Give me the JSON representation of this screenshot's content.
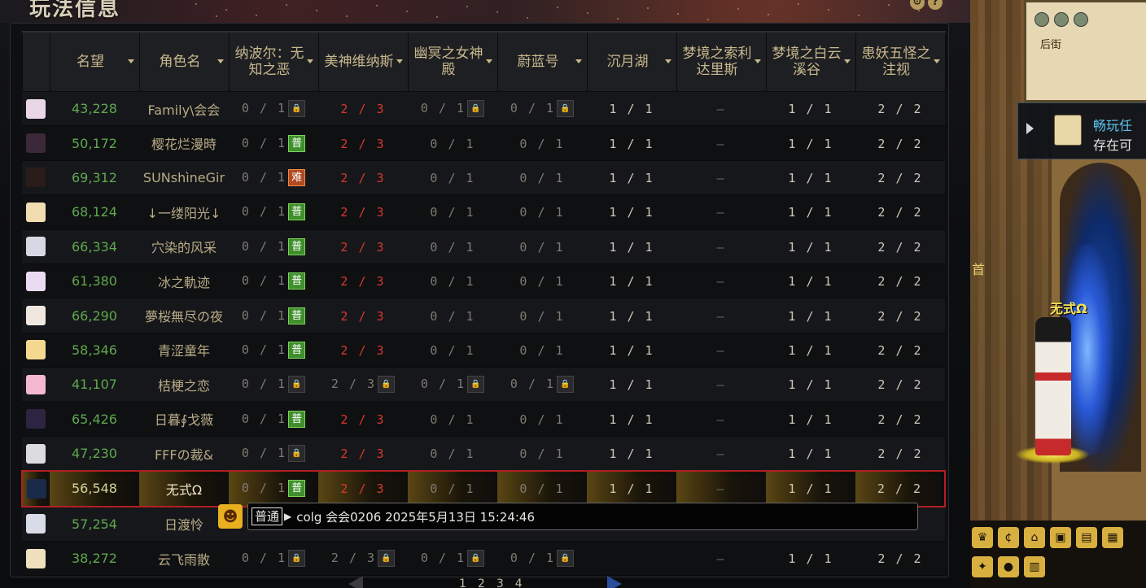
{
  "panel": {
    "title": "玩法信息",
    "settings_icon": "gear-icon",
    "help_icon": "help-icon"
  },
  "columns": [
    {
      "label": "名望"
    },
    {
      "label": "角色名"
    },
    {
      "label": "纳波尔：无知之恶"
    },
    {
      "label": "美神维纳斯"
    },
    {
      "label": "幽冥之女神殿"
    },
    {
      "label": "蔚蓝号"
    },
    {
      "label": "沉月湖"
    },
    {
      "label": "梦境之索利达里斯"
    },
    {
      "label": "梦境之白云溪谷"
    },
    {
      "label": "患妖五怪之注视"
    }
  ],
  "rows": [
    {
      "score": "43,228",
      "name": "Family\\会会",
      "d1": "0 / 1",
      "d1b": "lock",
      "d2": "2 / 3",
      "d2r": true,
      "d3": "0 / 1",
      "d3b": "lock",
      "d4": "0 / 1",
      "d4b": "lock",
      "d5": "1 / 1",
      "d6": "—",
      "d7": "1 / 1",
      "d8": "2 / 2",
      "av": "#e9d7e8"
    },
    {
      "score": "50,172",
      "name": "樱花烂漫時",
      "d1": "0 / 1",
      "d1b": "普",
      "d2": "2 / 3",
      "d2r": true,
      "d3": "0 / 1",
      "d4": "0 / 1",
      "d5": "1 / 1",
      "d6": "—",
      "d7": "1 / 1",
      "d8": "2 / 2",
      "av": "#3b2838"
    },
    {
      "score": "69,312",
      "name": "SUNshìneGir",
      "d1": "0 / 1",
      "d1b": "难",
      "d2": "2 / 3",
      "d2r": true,
      "d3": "0 / 1",
      "d4": "0 / 1",
      "d5": "1 / 1",
      "d6": "—",
      "d7": "1 / 1",
      "d8": "2 / 2",
      "av": "#2a1c1a"
    },
    {
      "score": "68,124",
      "name": "↓一缕阳光↓",
      "d1": "0 / 1",
      "d1b": "普",
      "d2": "2 / 3",
      "d2r": true,
      "d3": "0 / 1",
      "d4": "0 / 1",
      "d5": "1 / 1",
      "d6": "—",
      "d7": "1 / 1",
      "d8": "2 / 2",
      "av": "#f0dcb0"
    },
    {
      "score": "66,334",
      "name": "穴染的风采",
      "d1": "0 / 1",
      "d1b": "普",
      "d2": "2 / 3",
      "d2r": true,
      "d3": "0 / 1",
      "d4": "0 / 1",
      "d5": "1 / 1",
      "d6": "—",
      "d7": "1 / 1",
      "d8": "2 / 2",
      "av": "#d8d8e4"
    },
    {
      "score": "61,380",
      "name": "冰之軌迹",
      "d1": "0 / 1",
      "d1b": "普",
      "d2": "2 / 3",
      "d2r": true,
      "d3": "0 / 1",
      "d4": "0 / 1",
      "d5": "1 / 1",
      "d6": "—",
      "d7": "1 / 1",
      "d8": "2 / 2",
      "av": "#eadcf0"
    },
    {
      "score": "66,290",
      "name": "夢桜無尽の夜",
      "d1": "0 / 1",
      "d1b": "普",
      "d2": "2 / 3",
      "d2r": true,
      "d3": "0 / 1",
      "d4": "0 / 1",
      "d5": "1 / 1",
      "d6": "—",
      "d7": "1 / 1",
      "d8": "2 / 2",
      "av": "#f0e8e0"
    },
    {
      "score": "58,346",
      "name": "青涩童年",
      "d1": "0 / 1",
      "d1b": "普",
      "d2": "2 / 3",
      "d2r": true,
      "d3": "0 / 1",
      "d4": "0 / 1",
      "d5": "1 / 1",
      "d6": "—",
      "d7": "1 / 1",
      "d8": "2 / 2",
      "av": "#f4d890"
    },
    {
      "score": "41,107",
      "name": "桔梗之恋",
      "d1": "0 / 1",
      "d1b": "lock",
      "d2": "2 / 3",
      "d2b": "lock",
      "d3": "0 / 1",
      "d3b": "lock",
      "d4": "0 / 1",
      "d4b": "lock",
      "d5": "1 / 1",
      "d6": "—",
      "d7": "1 / 1",
      "d8": "2 / 2",
      "av": "#f4b8d0"
    },
    {
      "score": "65,426",
      "name": "日暮∮戈薇",
      "d1": "0 / 1",
      "d1b": "普",
      "d2": "2 / 3",
      "d2r": true,
      "d3": "0 / 1",
      "d4": "0 / 1",
      "d5": "1 / 1",
      "d6": "—",
      "d7": "1 / 1",
      "d8": "2 / 2",
      "av": "#2c2440"
    },
    {
      "score": "47,230",
      "name": "FFFの裁&",
      "d1": "0 / 1",
      "d1b": "lock",
      "d2": "2 / 3",
      "d2r": true,
      "d3": "0 / 1",
      "d4": "0 / 1",
      "d5": "1 / 1",
      "d6": "—",
      "d7": "1 / 1",
      "d8": "2 / 2",
      "av": "#dcdce0"
    },
    {
      "score": "56,548",
      "name": "无式Ω",
      "d1": "0 / 1",
      "d1b": "普",
      "d2": "2 / 3",
      "d2r": true,
      "d3": "0 / 1",
      "d4": "0 / 1",
      "d5": "1 / 1",
      "d6": "—",
      "d7": "1 / 1",
      "d8": "2 / 2",
      "av": "#1a2a4a",
      "selected": true
    },
    {
      "score": "57,254",
      "name": "日渡怜",
      "chat": true,
      "av": "#d8dce8"
    },
    {
      "score": "38,272",
      "name": "云飞雨散",
      "d1": "0 / 1",
      "d1b": "lock",
      "d2": "2 / 3",
      "d2b": "lock",
      "d3": "0 / 1",
      "d3b": "lock",
      "d4": "0 / 1",
      "d4b": "lock",
      "d5": "",
      "d6": "—",
      "d7": "1 / 1",
      "d8": "2 / 2",
      "av": "#f0e0c0"
    }
  ],
  "chat": {
    "channel": "普通",
    "message": "colg 会会0206 2025年5月13日 15:24:46"
  },
  "pager": {
    "pages": [
      "1",
      "2",
      "3",
      "4"
    ]
  },
  "scene": {
    "map_label": "后街",
    "quest_line1": "畅玩任",
    "quest_line2": "存在可",
    "side_text": "首",
    "player_name": "无式Ω"
  }
}
